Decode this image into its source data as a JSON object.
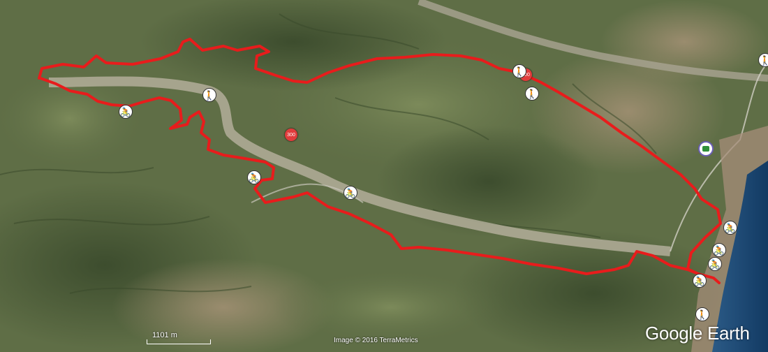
{
  "map": {
    "scale_label": "1101 m",
    "credit": "Image © 2016 TerraMetrics",
    "brand": "Google Earth",
    "route_color": "#e81c1c",
    "badges": [
      {
        "label": "300",
        "color": "#e03c3c"
      },
      {
        "label": "300",
        "color": "#e03c3c"
      }
    ],
    "markers": [
      {
        "type": "hiking",
        "icon": "hiking-icon"
      },
      {
        "type": "cycling",
        "icon": "cycling-icon"
      },
      {
        "type": "hiking",
        "icon": "hiking-icon"
      },
      {
        "type": "hiking",
        "icon": "hiking-icon"
      },
      {
        "type": "cycling",
        "icon": "cycling-icon"
      },
      {
        "type": "cycling",
        "icon": "cycling-icon"
      },
      {
        "type": "cycling",
        "icon": "cycling-icon"
      },
      {
        "type": "cycling",
        "icon": "cycling-icon"
      },
      {
        "type": "cycling",
        "icon": "cycling-icon"
      },
      {
        "type": "cycling",
        "icon": "cycling-icon"
      },
      {
        "type": "hiking",
        "icon": "hiking-icon"
      },
      {
        "type": "hiking",
        "icon": "hiking-icon"
      }
    ]
  }
}
